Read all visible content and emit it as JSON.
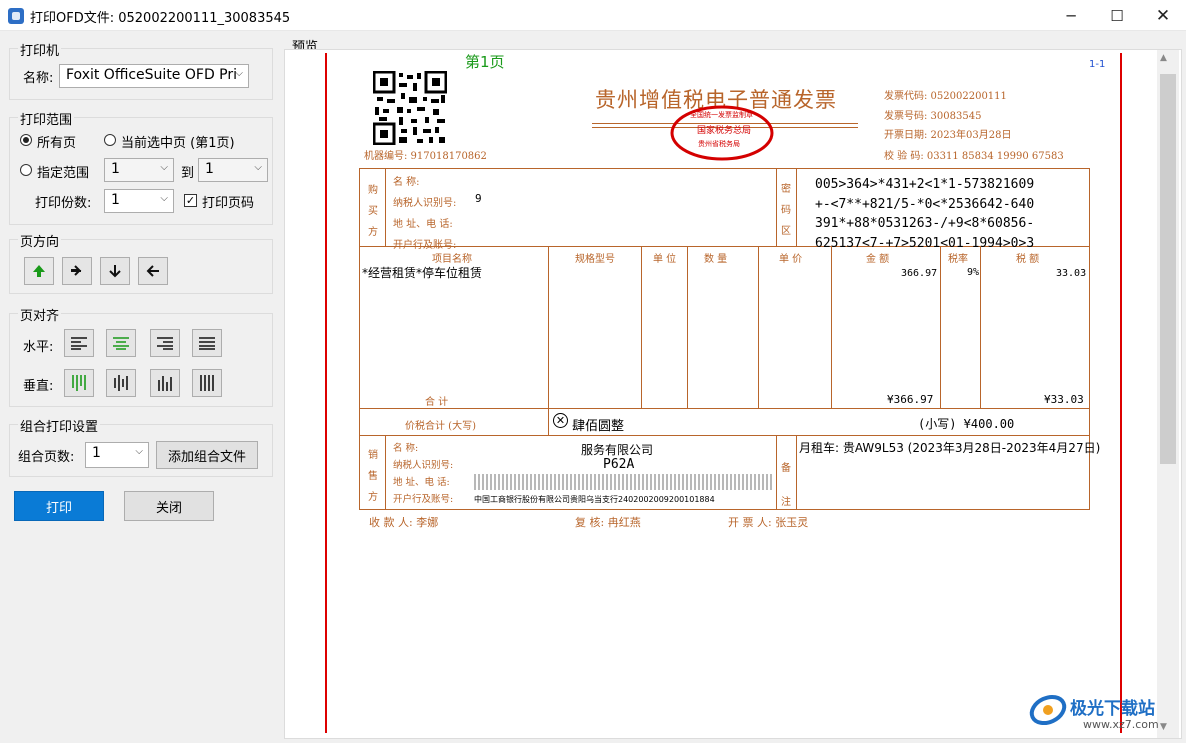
{
  "window": {
    "title": "打印OFD文件: 052002200111_30083545"
  },
  "printer": {
    "group_title": "打印机",
    "name_label": "名称:",
    "name_value": "Foxit OfficeSuite OFD Pri"
  },
  "range": {
    "group_title": "打印范围",
    "all_pages": "所有页",
    "current_page": "当前选中页 (第1页)",
    "specified": "指定范围",
    "from_value": "1",
    "to_label": "到",
    "to_value": "1",
    "copies_label": "打印份数:",
    "copies_value": "1",
    "print_page_number": "打印页码"
  },
  "orientation": {
    "group_title": "页方向"
  },
  "align": {
    "group_title": "页对齐",
    "horizontal_label": "水平:",
    "vertical_label": "垂直:"
  },
  "combine": {
    "group_title": "组合打印设置",
    "pages_label": "组合页数:",
    "pages_value": "1",
    "add_button": "添加组合文件"
  },
  "buttons": {
    "print": "打印",
    "close": "关闭"
  },
  "preview": {
    "label": "预览",
    "page_label": "第1页",
    "page_index": "1-1",
    "invoice": {
      "title": "贵州增值税电子普通发票",
      "machine_no": "机器编号: 917018170862",
      "code": "发票代码: 052002200111",
      "number": "发票号码: 30083545",
      "date": "开票日期: 2023年03月28日",
      "check": "校 验 码: 03311 85834 19990 67583",
      "stamp_top": "全国统一发票监制章",
      "stamp_mid": "国家税务总局",
      "stamp_bottom": "贵州省税务局",
      "buyer_side": [
        "购",
        "买",
        "方"
      ],
      "buyer_fields": [
        "名        称:",
        "纳税人识别号:",
        "地 址、电 话:",
        "开户行及账号:"
      ],
      "buyer_taxid_fragment": "9",
      "cipher_side": [
        "密",
        "码",
        "区"
      ],
      "cipher": [
        "005>364>*431+2<1*1-573821609",
        "+-<7**+821/5-*0<*2536642-640",
        "391*+88*0531263-/+9<8*60856-",
        "625137<7-+7>5201<01-1994>0>3"
      ],
      "headers": [
        "项目名称",
        "规格型号",
        "单 位",
        "数 量",
        "单 价",
        "金 额",
        "税率",
        "税 额"
      ],
      "item_name": "*经营租赁*停车位租赁",
      "amount": "366.97",
      "rate": "9%",
      "tax": "33.03",
      "total_label": "合        计",
      "total_amount": "¥366.97",
      "total_tax": "¥33.03",
      "grand_label": "价税合计 (大写)",
      "grand_upper": "肆佰圆整",
      "grand_lower": "(小写) ¥400.00",
      "seller_side": [
        "销",
        "售",
        "方"
      ],
      "seller_fields": [
        "名        称:",
        "纳税人识别号:",
        "地 址、电 话:",
        "开户行及账号:"
      ],
      "seller_name": "服务有限公司",
      "seller_taxid": "P62A",
      "seller_bank": "中国工商银行股份有限公司贵阳乌当支行2402002009200101884",
      "remark_side": [
        "备",
        "注"
      ],
      "remark": "月租车: 贵AW9L53 (2023年3月28日-2023年4月27日)",
      "payee": "收 款 人: 李娜",
      "reviewer": "复 核: 冉红燕",
      "issuer": "开 票 人: 张玉灵"
    }
  },
  "watermark": {
    "text": "极光下载站",
    "url": "www.xz7.com"
  },
  "colors": {
    "accent": "#0078d7",
    "invoice": "#b8652b",
    "page_border": "#dd0000",
    "page_label": "#1a9a1a",
    "stamp": "#d40000"
  }
}
